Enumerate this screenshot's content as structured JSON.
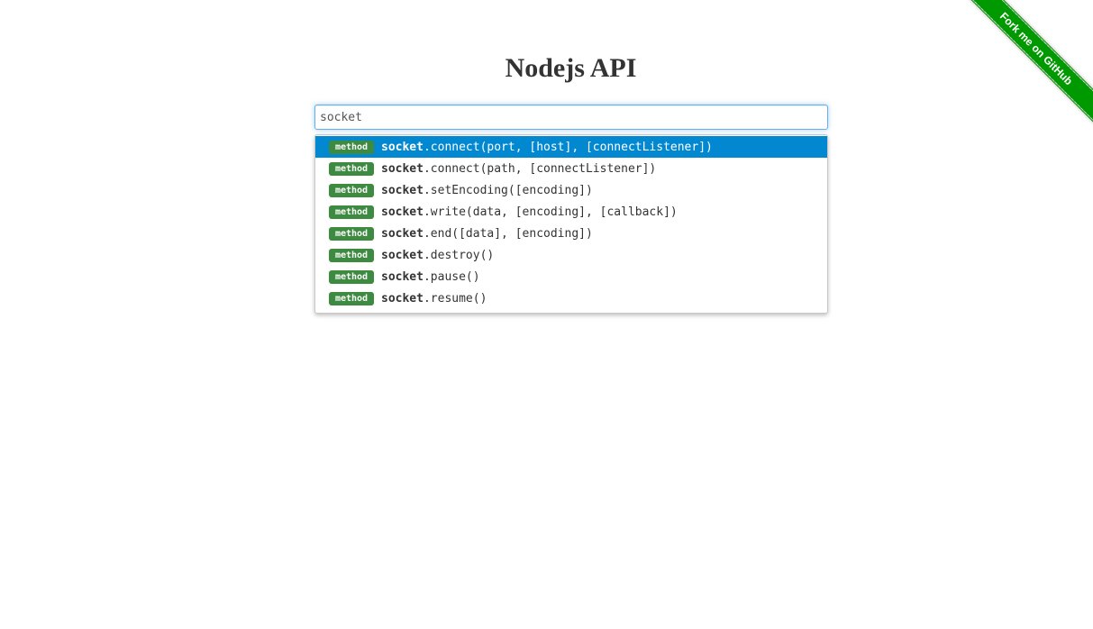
{
  "header": {
    "title": "Nodejs API"
  },
  "search": {
    "value": "socket",
    "placeholder": ""
  },
  "results": [
    {
      "type": "method",
      "term": "socket",
      "rest": ".connect(port, [host], [connectListener])",
      "active": true
    },
    {
      "type": "method",
      "term": "socket",
      "rest": ".connect(path, [connectListener])",
      "active": false
    },
    {
      "type": "method",
      "term": "socket",
      "rest": ".setEncoding([encoding])",
      "active": false
    },
    {
      "type": "method",
      "term": "socket",
      "rest": ".write(data, [encoding], [callback])",
      "active": false
    },
    {
      "type": "method",
      "term": "socket",
      "rest": ".end([data], [encoding])",
      "active": false
    },
    {
      "type": "method",
      "term": "socket",
      "rest": ".destroy()",
      "active": false
    },
    {
      "type": "method",
      "term": "socket",
      "rest": ".pause()",
      "active": false
    },
    {
      "type": "method",
      "term": "socket",
      "rest": ".resume()",
      "active": false
    }
  ],
  "ribbon": {
    "label": "Fork me on GitHub"
  },
  "colors": {
    "highlight": "#0288d1",
    "badge": "#3d8b40",
    "ribbon": "#009900",
    "input_focus_border": "#66afe9"
  }
}
